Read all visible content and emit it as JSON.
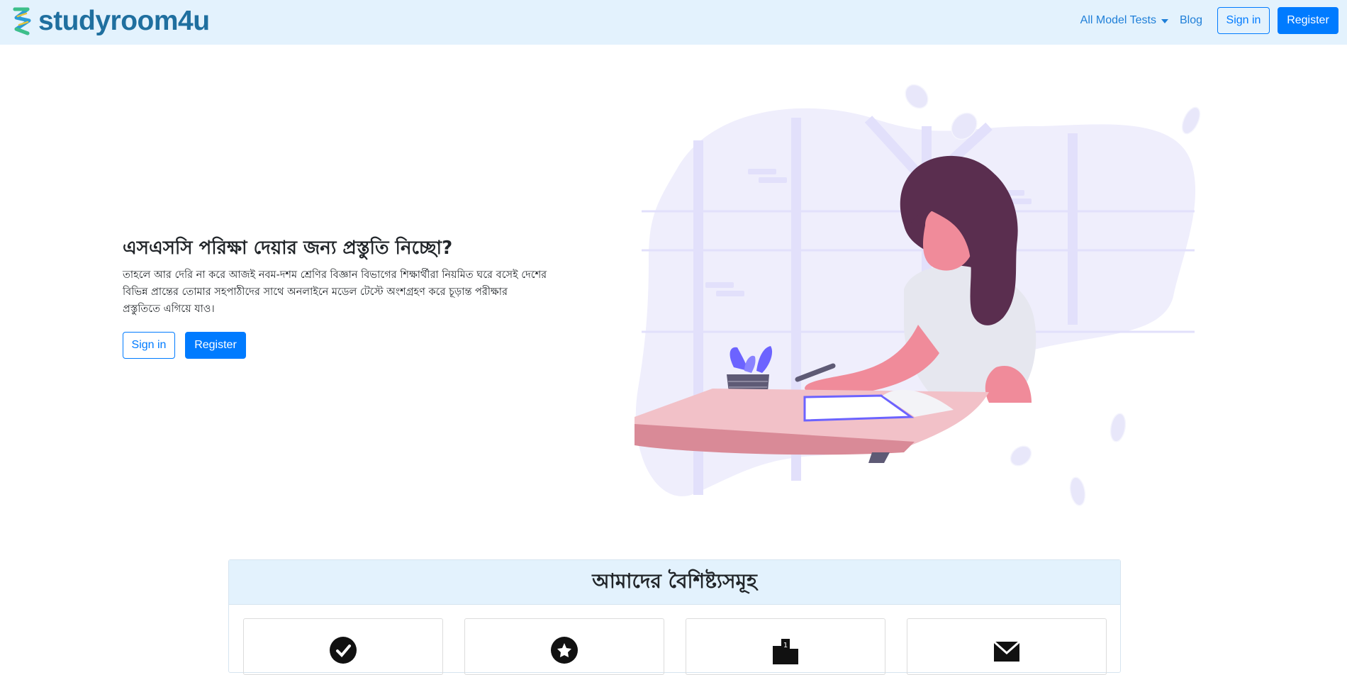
{
  "navbar": {
    "brand": "studyroom4u",
    "links": {
      "model_tests": "All Model Tests",
      "blog": "Blog"
    },
    "signin": "Sign in",
    "register": "Register"
  },
  "hero": {
    "title": "এসএসসি পরিক্ষা দেয়ার জন্য প্রস্তুতি নিচ্ছো?",
    "description": "তাহলে আর দেরি না করে আজই নবম-দশম শ্রেণির বিজ্ঞান বিভাগের শিক্ষার্থীরা নিয়মিত ঘরে বসেই দেশের বিভিন্ন প্রান্তের তোমার সহপাঠীদের সাথে অনলাইনে মডেল টেস্টে অংশগ্রহণ করে চূড়ান্ত পরীক্ষার প্রস্তুতিতে এগিয়ে যাও।",
    "signin": "Sign in",
    "register": "Register"
  },
  "features": {
    "title": "আমাদের বৈশিষ্ট্যসমূহ",
    "cards": [
      {
        "icon": "check-circle-icon"
      },
      {
        "icon": "award-icon"
      },
      {
        "icon": "podium-icon"
      },
      {
        "icon": "envelope-icon"
      }
    ]
  },
  "colors": {
    "navbar_bg": "#e3f2fd",
    "primary": "#007bff",
    "brand": "#1f6f9f"
  }
}
